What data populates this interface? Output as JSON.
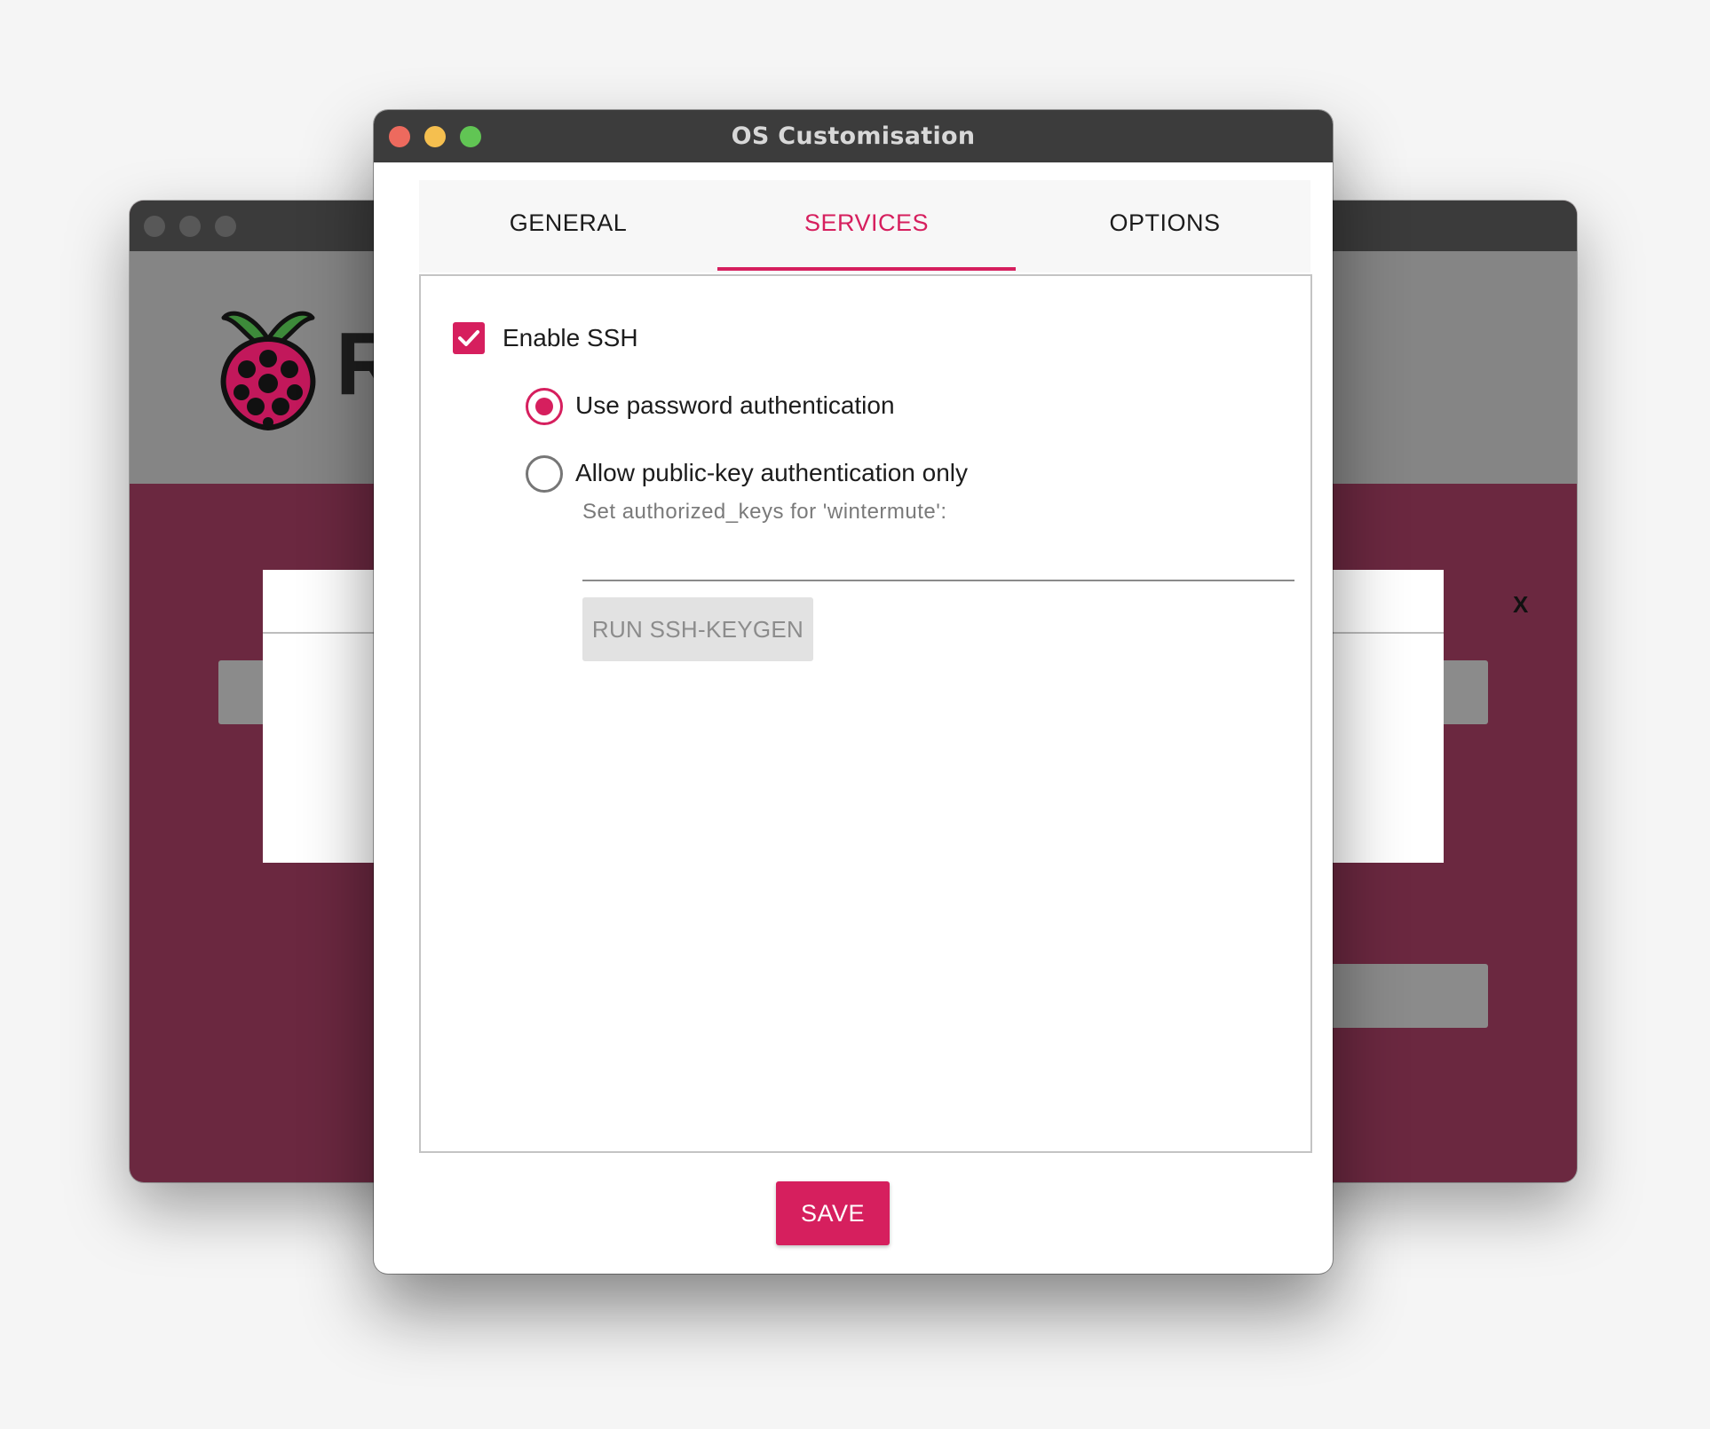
{
  "window": {
    "title": "OS Customisation"
  },
  "tabs": [
    {
      "label": "GENERAL",
      "active": false
    },
    {
      "label": "SERVICES",
      "active": true
    },
    {
      "label": "OPTIONS",
      "active": false
    }
  ],
  "services": {
    "enable_ssh": {
      "label": "Enable SSH",
      "checked": true
    },
    "auth_options": [
      {
        "label": "Use password authentication",
        "selected": true
      },
      {
        "label": "Allow public-key authentication only",
        "selected": false
      }
    ],
    "authorized_keys": {
      "label": "Set authorized_keys for 'wintermute':",
      "value": ""
    },
    "keygen_button": "RUN SSH-KEYGEN"
  },
  "footer": {
    "save_label": "SAVE"
  },
  "background_app": {
    "dialog_close": "X"
  },
  "colors": {
    "accent": "#d61f5e",
    "titlebar": "#3c3c3c",
    "traffic_close": "#ed6a5e",
    "traffic_minimize": "#f5bf4f",
    "traffic_maximize": "#61c554"
  },
  "icons": {
    "checkbox": "checkmark-icon",
    "logo": "raspberry-pi-logo-icon"
  }
}
